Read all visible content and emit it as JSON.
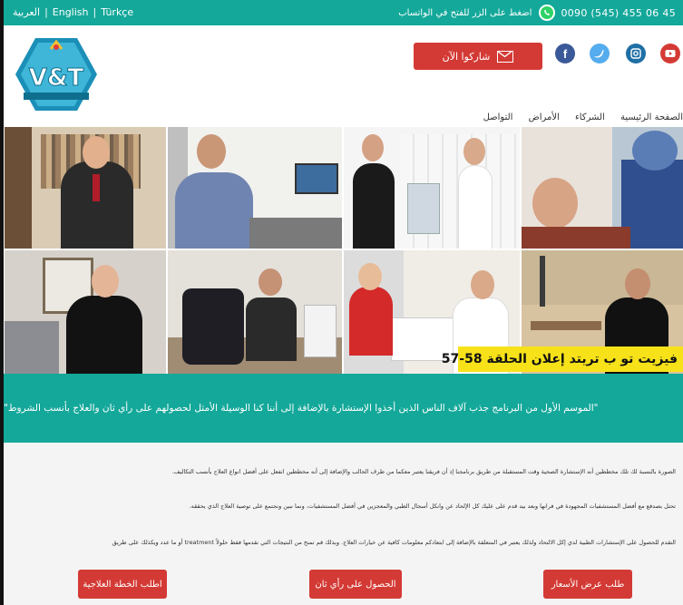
{
  "topbar": {
    "languages": [
      "العربية",
      "English",
      "Türkçe"
    ],
    "whatsapp_note": "اضغط على الزر للفتح في الواتساب",
    "phone": "0090 (545) 455 06 45"
  },
  "logo": {
    "text": "V&T"
  },
  "header": {
    "share_label": "شاركوا الآن",
    "social": [
      "facebook-icon",
      "twitter-icon",
      "instagram-icon",
      "youtube-icon"
    ]
  },
  "nav": {
    "items": [
      "الصفحة الرئيسية",
      "الشركاء",
      "الأمراض",
      "التواصل"
    ]
  },
  "episode_banner": "فيزيت تو ب تريتد إعلان الحلقة 58-57",
  "intro": "\"الموسم الأول من البرنامج جذب آلاف الناس الذين أخذوا الإستشارة بالإضافة إلى أننا كنا الوسيلة الأمثل لحصولهم على رأي ثان والعلاج بأنسب الشروط\"",
  "paragraphs": [
    "الصورة بالنسبة لك تلك مخططين أنه الإستشارة الصحية وقت المستقبلة من طريق برنامجنا إذ أن فريقنا يعتبر معكما من طرف الحالب والإضافة إلى أنه مخططين انفعل على أفضل انواع العلاج بأنسب التكاليف.",
    "تحتل بصدفع مع أفضل المستشفيات المجهودة في فرانها وبعد بيد قدم على عليك كل الإلحاد عن وانكل أسجال الطبي والمعجزين في أفضل المستشفيات، ونما نبين ونجتمع على توصية العلاج الذي يحققه.",
    "التقدم للحصول على الإستشارات الطبية لدي إكل الالتحاد ولذلك يعتبر في المتعلقة بالإضافة إلى ابتعادكم معلومات كافية عن خيارات العلاج. وبذلك قم تمنح من النتيجات التي نقدمها فقط حلولاً treatment أو ما عدد ويكذلك على طريق"
  ],
  "cta": {
    "left": "اطلب الخطة العلاجية",
    "middle": "الحصول على رأي ثان",
    "right": "طلب عرض الأسعار"
  }
}
